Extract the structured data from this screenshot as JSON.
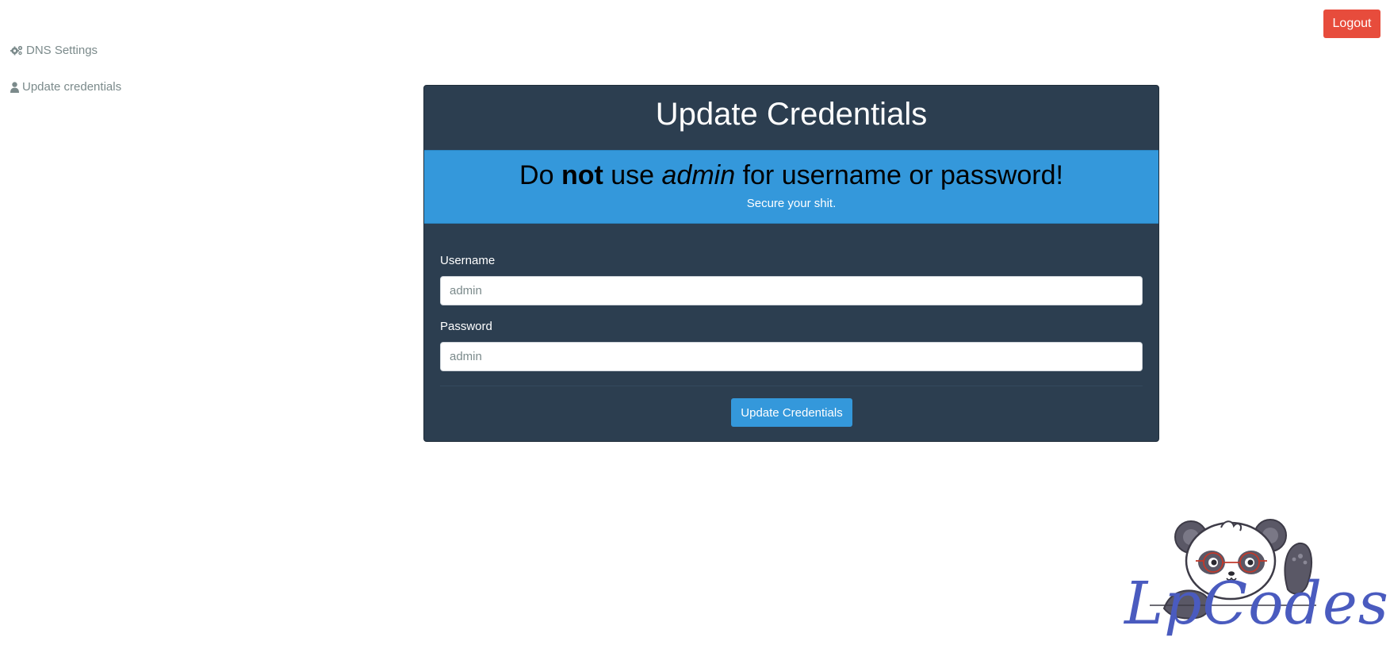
{
  "sidebar": {
    "items": [
      {
        "label": "DNS Settings",
        "icon": "gears-icon"
      },
      {
        "label": "Update credentials",
        "icon": "user-icon"
      }
    ]
  },
  "header": {
    "logout_label": "Logout",
    "logout_color": "#e74c3c"
  },
  "panel": {
    "title": "Update Credentials",
    "background": "#2c3e50",
    "alert": {
      "heading_pre": "Do ",
      "heading_bold": "not",
      "heading_mid": " use ",
      "heading_italic": "admin",
      "heading_post": " for username or password!",
      "subtext": "Secure your shit.",
      "background": "#3498db"
    },
    "username": {
      "label": "Username",
      "placeholder": "admin",
      "value": ""
    },
    "password": {
      "label": "Password",
      "placeholder": "admin",
      "value": ""
    },
    "submit_label": "Update Credentials"
  },
  "branding": {
    "logo_text": "LpCodes",
    "mascot": "panda-mascot-icon",
    "brand_color": "#4a5bbf"
  }
}
